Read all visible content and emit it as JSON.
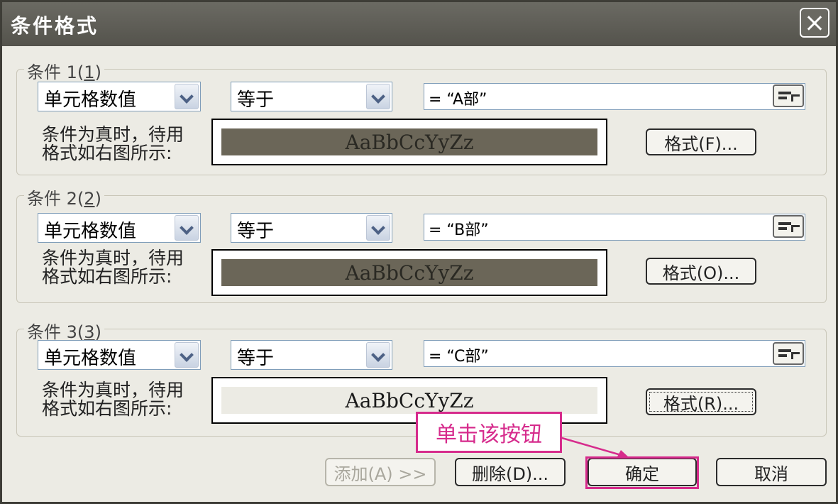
{
  "window": {
    "title": "条件格式"
  },
  "conditions": [
    {
      "legend_prefix": "条件 1",
      "legend_key": "1",
      "type_value": "单元格数值",
      "operator_value": "等于",
      "formula_value": "= “A部”",
      "desc_line1": "条件为真时，待用",
      "desc_line2": "格式如右图所示:",
      "preview_text": "AaBbCcYyZz",
      "preview_bg": "#6b6658",
      "format_label": "格式(F)..."
    },
    {
      "legend_prefix": "条件 2",
      "legend_key": "2",
      "type_value": "单元格数值",
      "operator_value": "等于",
      "formula_value": "= “B部”",
      "desc_line1": "条件为真时，待用",
      "desc_line2": "格式如右图所示:",
      "preview_text": "AaBbCcYyZz",
      "preview_bg": "#6b6658",
      "format_label": "格式(O)..."
    },
    {
      "legend_prefix": "条件 3",
      "legend_key": "3",
      "type_value": "单元格数值",
      "operator_value": "等于",
      "formula_value": "= “C部”",
      "desc_line1": "条件为真时，待用",
      "desc_line2": "格式如右图所示:",
      "preview_text": "AaBbCcYyZz",
      "preview_bg": "#ecebe4",
      "format_label": "格式(R)..."
    }
  ],
  "buttons": {
    "add": "添加(A) >>",
    "delete": "删除(D)...",
    "ok": "确定",
    "cancel": "取消"
  },
  "callout": {
    "text": "单击该按钮",
    "color": "#d62b8c"
  },
  "icons": {
    "close": "close-icon",
    "dropdown": "chevron-down-icon",
    "collapse": "collapse-dialog-icon"
  }
}
